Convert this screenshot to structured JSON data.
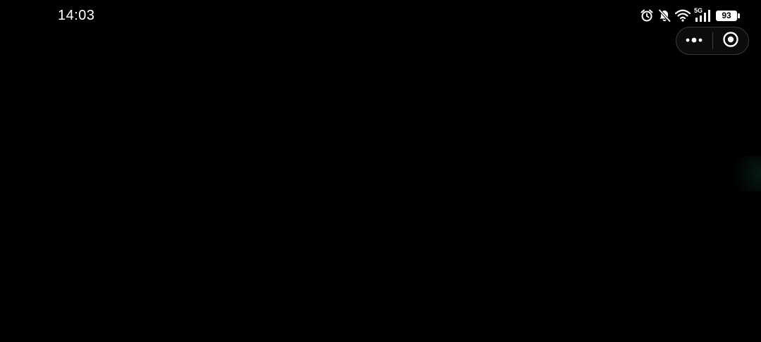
{
  "status_bar": {
    "time": "14:03",
    "network_type": "5G",
    "battery_level": "93",
    "icons": [
      "alarm-icon",
      "bell-muted-icon",
      "wifi-icon",
      "signal-icon",
      "battery-icon"
    ]
  },
  "capsule": {
    "menu_icon": "more-dots-icon",
    "close_icon": "target-close-icon"
  },
  "colors": {
    "background": "#000000",
    "foreground": "#ffffff"
  }
}
